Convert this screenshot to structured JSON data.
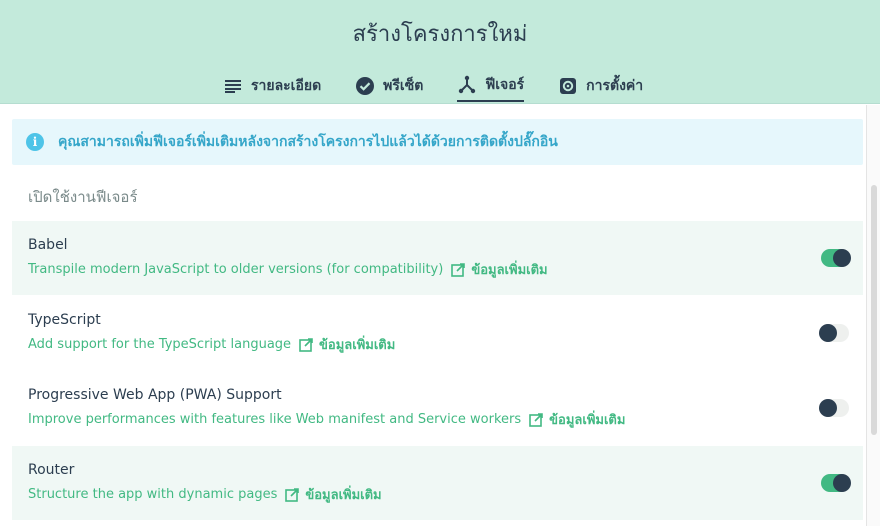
{
  "header": {
    "title": "สร้างโครงการใหม่",
    "tabs": [
      {
        "label": "รายละเอียด",
        "icon": "list-icon"
      },
      {
        "label": "พรีเซ็ต",
        "icon": "check-circle-icon"
      },
      {
        "label": "ฟีเจอร์",
        "icon": "fork-icon"
      },
      {
        "label": "การตั้งค่า",
        "icon": "gear-icon"
      }
    ],
    "active_tab": "ฟีเจอร์"
  },
  "info": {
    "icon": "info-icon",
    "text": "คุณสามารถเพิ่มฟีเจอร์เพิ่มเติมหลังจากสร้างโครงการไปแล้วได้ด้วยการติดตั้งปลั๊กอิน"
  },
  "section_title": "เปิดใช้งานฟีเจอร์",
  "features": [
    {
      "name": "Babel",
      "description": "Transpile modern JavaScript to older versions (for compatibility)",
      "more": "ข้อมูลเพิ่มเติม",
      "enabled": true
    },
    {
      "name": "TypeScript",
      "description": "Add support for the TypeScript language",
      "more": "ข้อมูลเพิ่มเติม",
      "enabled": false
    },
    {
      "name": "Progressive Web App (PWA) Support",
      "description": "Improve performances with features like Web manifest and Service workers",
      "more": "ข้อมูลเพิ่มเติม",
      "enabled": false
    },
    {
      "name": "Router",
      "description": "Structure the app with dynamic pages",
      "more": "ข้อมูลเพิ่มเติม",
      "enabled": true
    }
  ],
  "colors": {
    "header_bg": "#c3eadb",
    "accent": "#42b983",
    "text_dark": "#2c3e50",
    "info_bg": "#e6f7fc",
    "info_text": "#35a6c9"
  }
}
